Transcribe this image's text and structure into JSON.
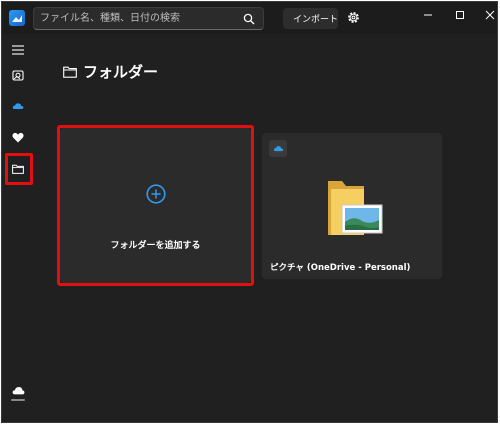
{
  "search": {
    "placeholder": "ファイル名、種類、日付の検索"
  },
  "toolbar": {
    "import_label": "インポート"
  },
  "page": {
    "title": "フォルダー"
  },
  "cards": {
    "add_folder_label": "フォルダーを追加する",
    "folder_label": "ピクチャ (OneDrive - Personal)"
  },
  "colors": {
    "accent": "#2e9bf0",
    "highlight": "#e20f0f",
    "background": "#202020",
    "card": "#2b2b2b"
  }
}
